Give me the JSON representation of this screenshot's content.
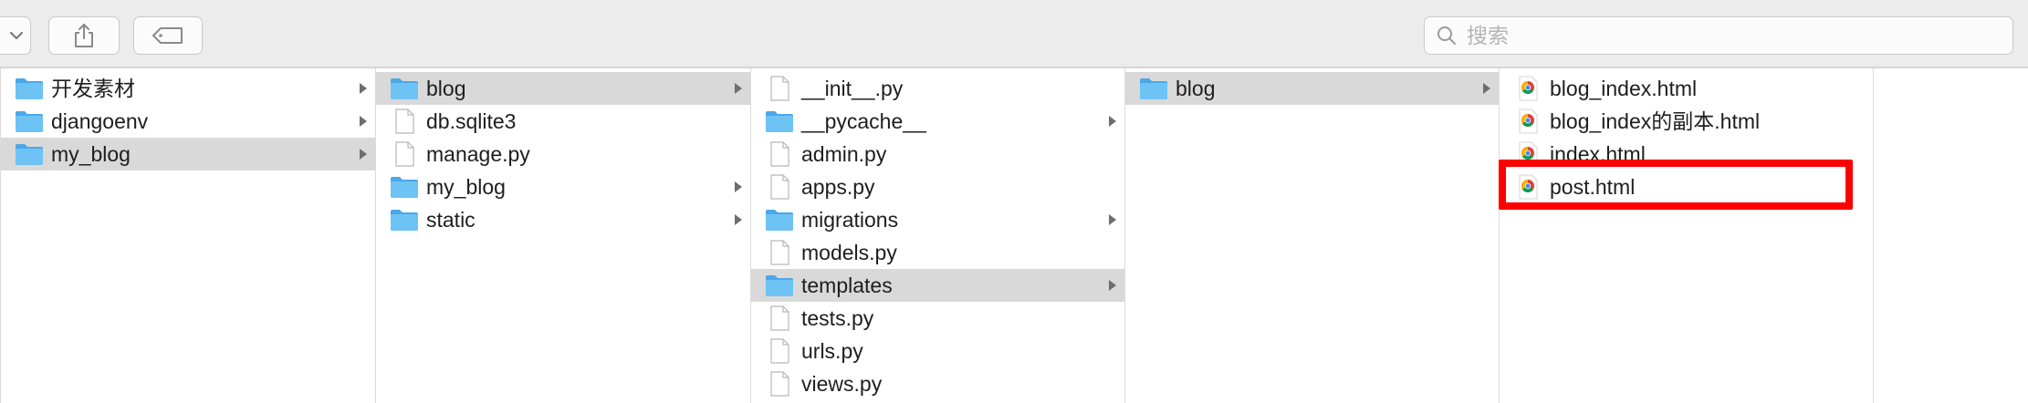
{
  "toolbar": {
    "icons": [
      "chevron-down-icon",
      "share-icon",
      "tag-icon",
      "search-icon"
    ],
    "search_placeholder": "搜索"
  },
  "columns": [
    {
      "items": [
        {
          "label": "开发素材",
          "kind": "folder",
          "has_children": true,
          "selected": false
        },
        {
          "label": "djangoenv",
          "kind": "folder",
          "has_children": true,
          "selected": false
        },
        {
          "label": "my_blog",
          "kind": "folder",
          "has_children": true,
          "selected": true
        }
      ]
    },
    {
      "items": [
        {
          "label": "blog",
          "kind": "folder",
          "has_children": true,
          "selected": true
        },
        {
          "label": "db.sqlite3",
          "kind": "file",
          "has_children": false,
          "selected": false
        },
        {
          "label": "manage.py",
          "kind": "file",
          "has_children": false,
          "selected": false
        },
        {
          "label": "my_blog",
          "kind": "folder",
          "has_children": true,
          "selected": false
        },
        {
          "label": "static",
          "kind": "folder",
          "has_children": true,
          "selected": false
        }
      ]
    },
    {
      "items": [
        {
          "label": "__init__.py",
          "kind": "file",
          "has_children": false,
          "selected": false
        },
        {
          "label": "__pycache__",
          "kind": "folder",
          "has_children": true,
          "selected": false
        },
        {
          "label": "admin.py",
          "kind": "file",
          "has_children": false,
          "selected": false
        },
        {
          "label": "apps.py",
          "kind": "file",
          "has_children": false,
          "selected": false
        },
        {
          "label": "migrations",
          "kind": "folder",
          "has_children": true,
          "selected": false
        },
        {
          "label": "models.py",
          "kind": "file",
          "has_children": false,
          "selected": false
        },
        {
          "label": "templates",
          "kind": "folder",
          "has_children": true,
          "selected": true
        },
        {
          "label": "tests.py",
          "kind": "file",
          "has_children": false,
          "selected": false
        },
        {
          "label": "urls.py",
          "kind": "file",
          "has_children": false,
          "selected": false
        },
        {
          "label": "views.py",
          "kind": "file",
          "has_children": false,
          "selected": false
        }
      ]
    },
    {
      "items": [
        {
          "label": "blog",
          "kind": "folder",
          "has_children": true,
          "selected": true
        }
      ]
    },
    {
      "items": [
        {
          "label": "blog_index.html",
          "kind": "html",
          "has_children": false,
          "selected": false
        },
        {
          "label": "blog_index的副本.html",
          "kind": "html",
          "has_children": false,
          "selected": false
        },
        {
          "label": "index.html",
          "kind": "html",
          "has_children": false,
          "selected": false
        },
        {
          "label": "post.html",
          "kind": "html",
          "has_children": false,
          "selected": false,
          "highlighted": true
        }
      ]
    },
    {
      "items": []
    }
  ],
  "colors": {
    "folder": "#6ec3f5",
    "selection": "#d9d9d9",
    "highlight": "#ff0000"
  }
}
